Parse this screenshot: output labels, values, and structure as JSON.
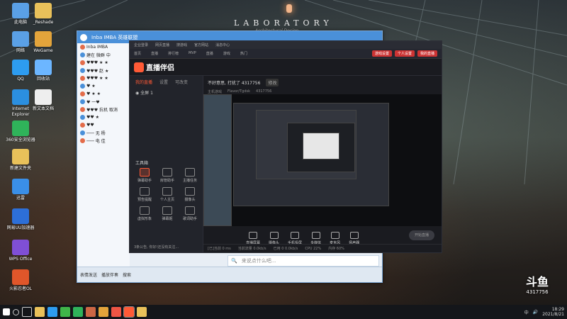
{
  "wallpaper": {
    "title": "LABORATORY",
    "subtitle": "Architectural Design"
  },
  "desktop_icons": [
    {
      "label": "此电脑",
      "icon": "computer-icon",
      "color": "#5aa0e6"
    },
    {
      "label": "_Reshade",
      "icon": "folder-icon",
      "color": "#e9c15a"
    },
    {
      "label": "网络",
      "icon": "network-icon",
      "color": "#5aa0e6"
    },
    {
      "label": "WeGame",
      "icon": "wegame-icon",
      "color": "#e3a43b"
    },
    {
      "label": "QQ",
      "icon": "qq-icon",
      "color": "#2d9cf0"
    },
    {
      "label": "回收站",
      "icon": "recycle-icon",
      "color": "#6cb6ff"
    },
    {
      "label": "Internet Explorer",
      "icon": "ie-icon",
      "color": "#2b8fe0"
    },
    {
      "label": "新文本文档",
      "icon": "document-icon",
      "color": "#eeeeee"
    },
    {
      "label": "360安全浏览器",
      "icon": "browser-icon",
      "color": "#2fb35a"
    },
    {
      "label": "新建文件夹",
      "icon": "folder-icon",
      "color": "#e9c15a"
    },
    {
      "label": "迅雷",
      "icon": "xunlei-icon",
      "color": "#3a8fe8"
    },
    {
      "label": "网易UU加速器",
      "icon": "uu-icon",
      "color": "#2d6fd8"
    },
    {
      "label": "WPS Office",
      "icon": "wps-icon",
      "color": "#7f4fd6"
    },
    {
      "label": "火影忍者OL",
      "icon": "game-icon",
      "color": "#e0562a"
    }
  ],
  "qq": {
    "title": "Inba IMBA 英雄联盟",
    "contacts": [
      {
        "name": "Inba IMBA",
        "badge": "群"
      },
      {
        "name": "建在 微群 中",
        "badge": ""
      },
      {
        "name": "♥♥♥  ★  ★",
        "badge": ""
      },
      {
        "name": "♥♥♥ 赵  ★",
        "badge": ""
      },
      {
        "name": "♥♥♥  ★  ★",
        "badge": ""
      },
      {
        "name": "♥  ★",
        "badge": ""
      },
      {
        "name": "♥  ★  ★",
        "badge": ""
      },
      {
        "name": "♥ 一♥",
        "badge": ""
      },
      {
        "name": "♥♥♥ 抗机  取消",
        "badge": ""
      },
      {
        "name": "♥♥  ★",
        "badge": ""
      },
      {
        "name": "♥♥",
        "badge": ""
      },
      {
        "name": "───  无 杨",
        "badge": ""
      },
      {
        "name": "───  电 佳",
        "badge": ""
      }
    ],
    "message_placeholder": "来说点什么吧...",
    "bottom_items": [
      "表情发送",
      "播放伴奏",
      "搜索"
    ]
  },
  "live": {
    "web_links": [
      "企业登录",
      "网页直播",
      "搜游戏",
      "官方网站",
      "消息中心"
    ],
    "nav": [
      "首页",
      "直播",
      "排行榜",
      "MVP",
      "直播",
      "游戏",
      "热门"
    ],
    "nav_buttons": [
      "游戏设置",
      "个人设置",
      "我的直播"
    ],
    "app_name": "直播伴侣",
    "side_tabs": [
      "我的直播",
      "设置",
      "可改变"
    ],
    "scene": "全屏 1",
    "tools_title": "工具箱",
    "tools": [
      {
        "label": "弹幕助手",
        "active": true
      },
      {
        "label": "房管助手",
        "active": false
      },
      {
        "label": "主播任务",
        "active": false
      },
      {
        "label": "预告提醒",
        "active": false
      },
      {
        "label": "个人主页",
        "active": false
      },
      {
        "label": "摄像头",
        "active": false
      },
      {
        "label": "虚拟形象",
        "active": false
      },
      {
        "label": "弹幕姬",
        "active": false
      },
      {
        "label": "歌词助手",
        "active": false
      }
    ],
    "room_title": "不好意思, 打扰了 4317756",
    "room_tag": "修改",
    "room_meta": [
      "主机游戏",
      "Flavor/Tgdsk",
      "4317756"
    ],
    "controls": [
      "直播屏幕",
      "摄像头",
      "手机投屏",
      "多媒体",
      "麦克风",
      "扬声器"
    ],
    "start_button": "开始直播",
    "status_items": [
      "[已]当前 0 ms",
      "当前流量 0.0kb/s",
      "已用 0 0.0kb/s",
      "CPU 22%",
      "内存 60%"
    ],
    "side_footer": "3条公告, 你好!还没有关注..."
  },
  "taskbar": {
    "time": "18:29",
    "date": "2021/8/21",
    "lang": "中"
  },
  "overlay_logo": {
    "brand": "斗鱼",
    "room_id": "4317756"
  }
}
